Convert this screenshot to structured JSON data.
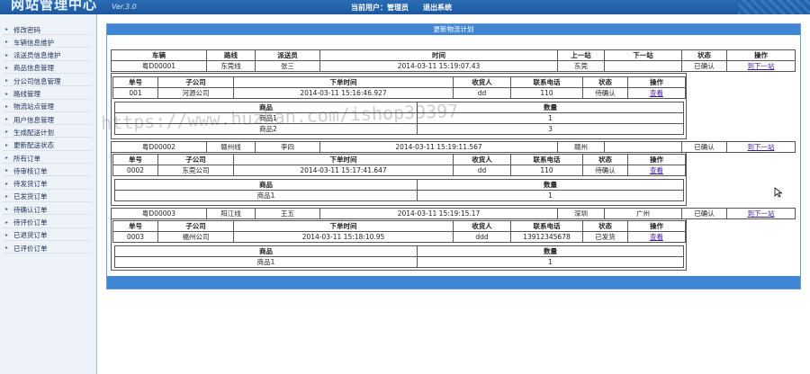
{
  "header": {
    "brand": "网站管理中心",
    "version": "Ver.3.0",
    "current_user_label": "当前用户：管理员",
    "logout_label": "退出系统"
  },
  "sidebar": {
    "items": [
      {
        "label": "修改密码"
      },
      {
        "label": "车辆信息维护"
      },
      {
        "label": "派送员信息维护"
      },
      {
        "label": "商品信息管理"
      },
      {
        "label": "分公司信息管理"
      },
      {
        "label": "路线管理"
      },
      {
        "label": "物流站点管理"
      },
      {
        "label": "用户信息管理"
      },
      {
        "label": "生成配送计划"
      },
      {
        "label": "更新配送状态"
      },
      {
        "label": "所有订单"
      },
      {
        "label": "待审核订单"
      },
      {
        "label": "待发货订单"
      },
      {
        "label": "已发货订单"
      },
      {
        "label": "待确认订单"
      },
      {
        "label": "待评价订单"
      },
      {
        "label": "已退货订单"
      },
      {
        "label": "已评价订单"
      }
    ]
  },
  "main": {
    "title": "更新物流计划",
    "plan_headers": [
      "车辆",
      "路线",
      "派送员",
      "时间",
      "上一站",
      "下一站",
      "状态",
      "操作"
    ],
    "order_headers": [
      "单号",
      "子公司",
      "下单时间",
      "收货人",
      "联系电话",
      "状态",
      "操作"
    ],
    "goods_headers": [
      "商品",
      "数量"
    ],
    "plans": [
      {
        "vehicle": "粤D00001",
        "route": "东莞线",
        "courier": "张三",
        "time": "2014-03-11 15:19:07.43",
        "prev_stop": "东莞",
        "next_stop": "",
        "status": "已确认",
        "action": "到下一站",
        "order": {
          "no": "001",
          "branch": "河源公司",
          "time": "2014-03-11 15:16:46.927",
          "receiver": "dd",
          "phone": "110",
          "status": "待确认",
          "action": "查看"
        },
        "goods": [
          {
            "name": "商品1",
            "qty": "1"
          },
          {
            "name": "商品2",
            "qty": "3"
          }
        ]
      },
      {
        "vehicle": "粤D00002",
        "route": "赣州线",
        "courier": "李四",
        "time": "2014-03-11 15:19:11.567",
        "prev_stop": "赣州",
        "next_stop": "",
        "status": "已确认",
        "action": "到下一站",
        "order": {
          "no": "0002",
          "branch": "东莞公司",
          "time": "2014-03-11 15:17:41.647",
          "receiver": "dd",
          "phone": "110",
          "status": "待确认",
          "action": "查看"
        },
        "goods": [
          {
            "name": "商品1",
            "qty": "1"
          }
        ]
      },
      {
        "vehicle": "粤D00003",
        "route": "阳江线",
        "courier": "王五",
        "time": "2014-03-11 15:19:15.17",
        "prev_stop": "深圳",
        "next_stop": "广州",
        "status": "已确认",
        "action": "到下一站",
        "order": {
          "no": "0003",
          "branch": "福州公司",
          "time": "2014-03-11 15:18:10.95",
          "receiver": "ddd",
          "phone": "13912345678",
          "status": "已发货",
          "action": "查看"
        },
        "goods": [
          {
            "name": "商品1",
            "qty": "1"
          }
        ]
      }
    ]
  },
  "watermark": "https://www.huzhan.com/ishop39397"
}
